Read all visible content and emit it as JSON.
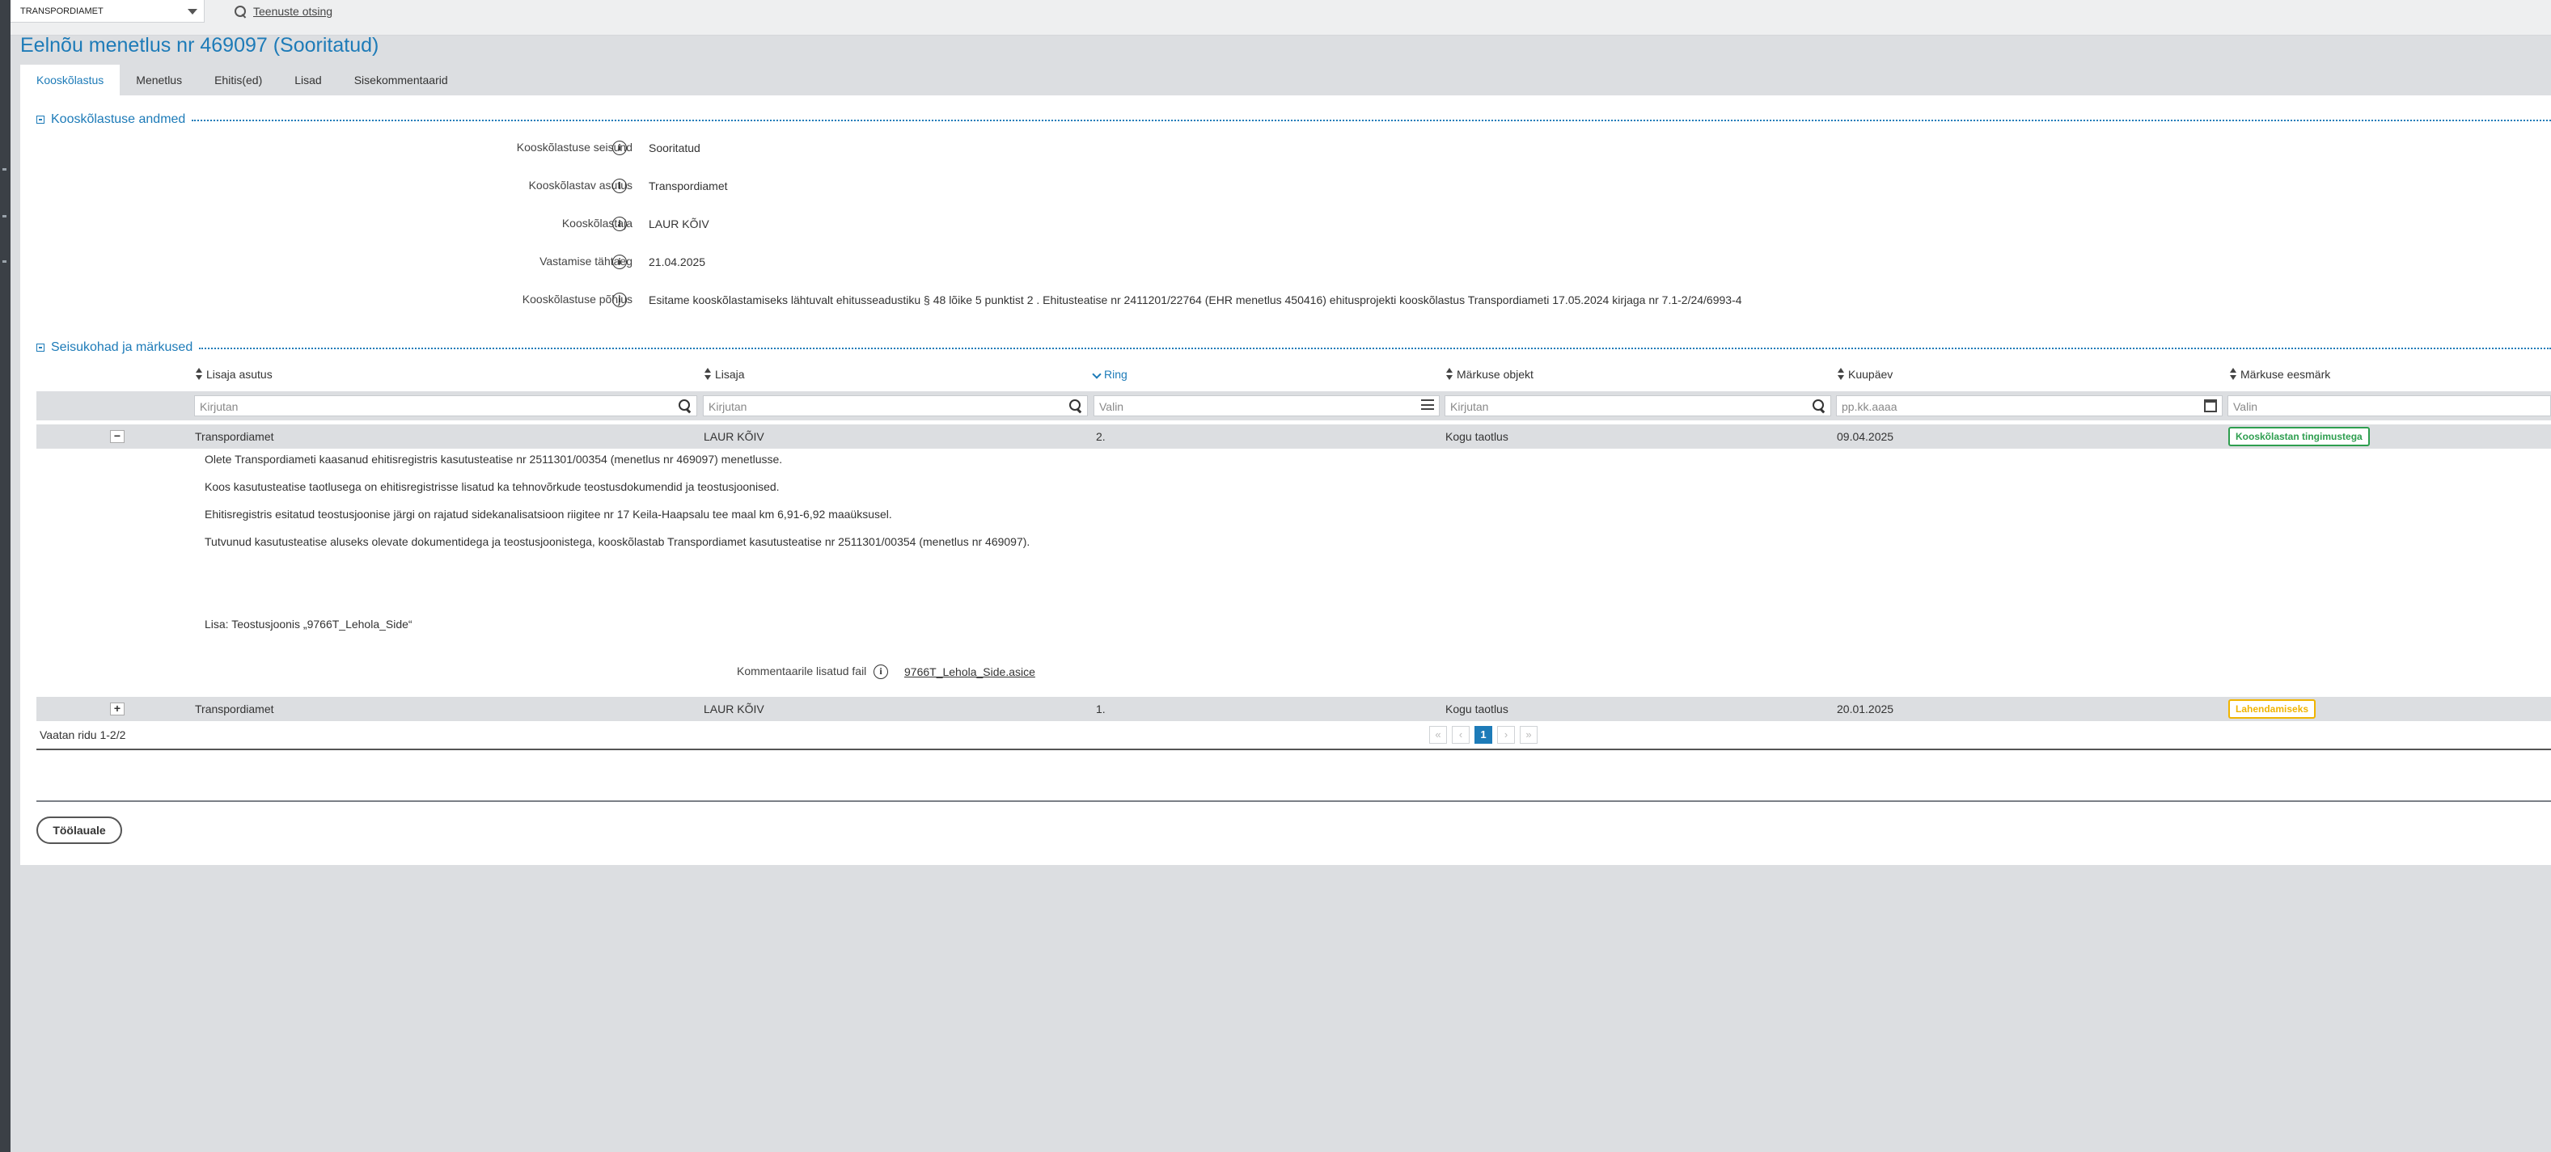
{
  "topbar": {
    "organization": "TRANSPORDIAMET",
    "service_search_label": "Teenuste otsing"
  },
  "page": {
    "title": "Eelnõu menetlus nr 469097 (Sooritatud)"
  },
  "tabs": [
    {
      "label": "Kooskõlastus",
      "active": true
    },
    {
      "label": "Menetlus"
    },
    {
      "label": "Ehitis(ed)"
    },
    {
      "label": "Lisad"
    },
    {
      "label": "Sisekommentaarid"
    }
  ],
  "section1": {
    "title": "Kooskõlastuse andmed",
    "fields": [
      {
        "label": "Kooskõlastuse seisund",
        "value": "Sooritatud"
      },
      {
        "label": "Kooskõlastav asutus",
        "value": "Transpordiamet"
      },
      {
        "label": "Kooskõlastaja",
        "value": "LAUR KÕIV"
      },
      {
        "label": "Vastamise tähtaeg",
        "value": "21.04.2025"
      },
      {
        "label": "Kooskõlastuse põhjus",
        "value": "Esitame kooskõlastamiseks lähtuvalt ehitusseadustiku § 48 lõike 5 punktist 2 . Ehitusteatise nr 2411201/22764 (EHR menetlus 450416) ehitusprojekti kooskõlastus Transpordiameti 17.05.2024 kirjaga nr 7.1-2/24/6993-4"
      }
    ]
  },
  "section2": {
    "title": "Seisukohad ja märkused",
    "columns": [
      "Lisaja asutus",
      "Lisaja",
      "Ring",
      "Märkuse objekt",
      "Kuupäev",
      "Märkuse eesmärk"
    ],
    "filters": {
      "lisaja_asutus": "Kirjutan",
      "lisaja": "Kirjutan",
      "ring": "Valin",
      "objekt": "Kirjutan",
      "kuupaev": "pp.kk.aaaa",
      "eesmark": "Valin"
    },
    "rows": [
      {
        "asutus": "Transpordiamet",
        "lisaja": "LAUR KÕIV",
        "ring": "2.",
        "objekt": "Kogu taotlus",
        "kuupaev": "09.04.2025",
        "eesmark": "Kooskõlastan tingimustega",
        "expander": "−"
      },
      {
        "asutus": "Transpordiamet",
        "lisaja": "LAUR KÕIV",
        "ring": "1.",
        "objekt": "Kogu taotlus",
        "kuupaev": "20.01.2025",
        "eesmark": "Lahendamiseks",
        "expander": "+"
      }
    ],
    "detail": {
      "paragraphs": [
        "Olete Transpordiameti kaasanud ehitisregistris kasutusteatise nr 2511301/00354 (menetlus nr 469097) menetlusse.",
        "Koos kasutusteatise taotlusega on ehitisregistrisse lisatud ka tehnovõrkude teostusdokumendid ja teostusjoonised.",
        "Ehitisregistris esitatud teostusjoonise järgi on rajatud sidekanalisatsioon riigitee nr 17 Keila-Haapsalu tee maal km 6,91-6,92 maaüksusel.",
        "Tutvunud kasutusteatise aluseks olevate dokumentidega ja teostusjoonistega, kooskõlastab Transpordiamet kasutusteatise nr 2511301/00354 (menetlus nr 469097)."
      ],
      "attachment_note": "Lisa: Teostusjoonis „9766T_Lehola_Side“",
      "file_label": "Kommentaarile lisatud fail",
      "file_name": "9766T_Lehola_Side.asice"
    },
    "footer": {
      "count": "Vaatan ridu 1-2/2",
      "current_page": "1"
    }
  },
  "actions": {
    "back_label": "Töölauale"
  },
  "colors": {
    "accent": "#1d7bb8",
    "badge_green": "#2e9e4f",
    "badge_yellow": "#f0b400"
  }
}
